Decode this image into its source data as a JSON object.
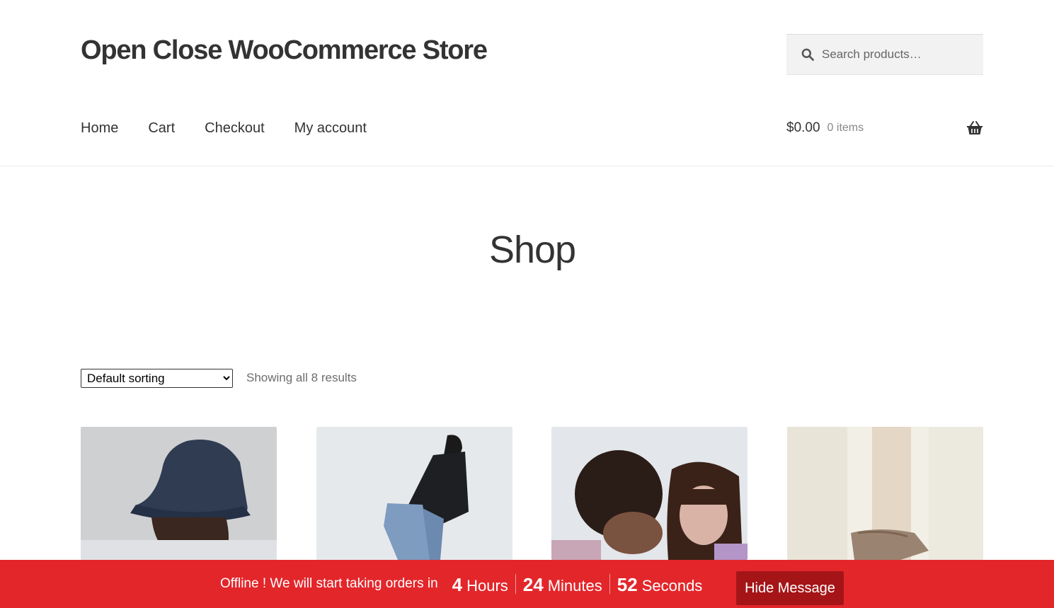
{
  "site": {
    "title": "Open Close WooCommerce Store"
  },
  "search": {
    "placeholder": "Search products…",
    "icon": "search-icon"
  },
  "nav": {
    "items": [
      {
        "label": "Home"
      },
      {
        "label": "Cart"
      },
      {
        "label": "Checkout"
      },
      {
        "label": "My account"
      }
    ]
  },
  "cart": {
    "amount": "$0.00",
    "count": "0 items",
    "icon": "basket-icon"
  },
  "page": {
    "title": "Shop"
  },
  "toolbar": {
    "sort_selected": "Default sorting",
    "result_count": "Showing all 8 results"
  },
  "products": [
    {
      "image": "man-in-navy-bucket-hat"
    },
    {
      "image": "woman-in-black-jacket-and-jeans"
    },
    {
      "image": "two-women-with-curly-and-dark-hair"
    },
    {
      "image": "person-in-cream-shirt"
    }
  ],
  "notice": {
    "message": "Offline ! We will start taking orders in",
    "hours_value": "4",
    "hours_label": "Hours",
    "minutes_value": "24",
    "minutes_label": "Minutes",
    "seconds_value": "52",
    "seconds_label": "Seconds",
    "button_label": "Hide Message",
    "bar_color": "#e3262a",
    "button_color": "#a51518"
  }
}
